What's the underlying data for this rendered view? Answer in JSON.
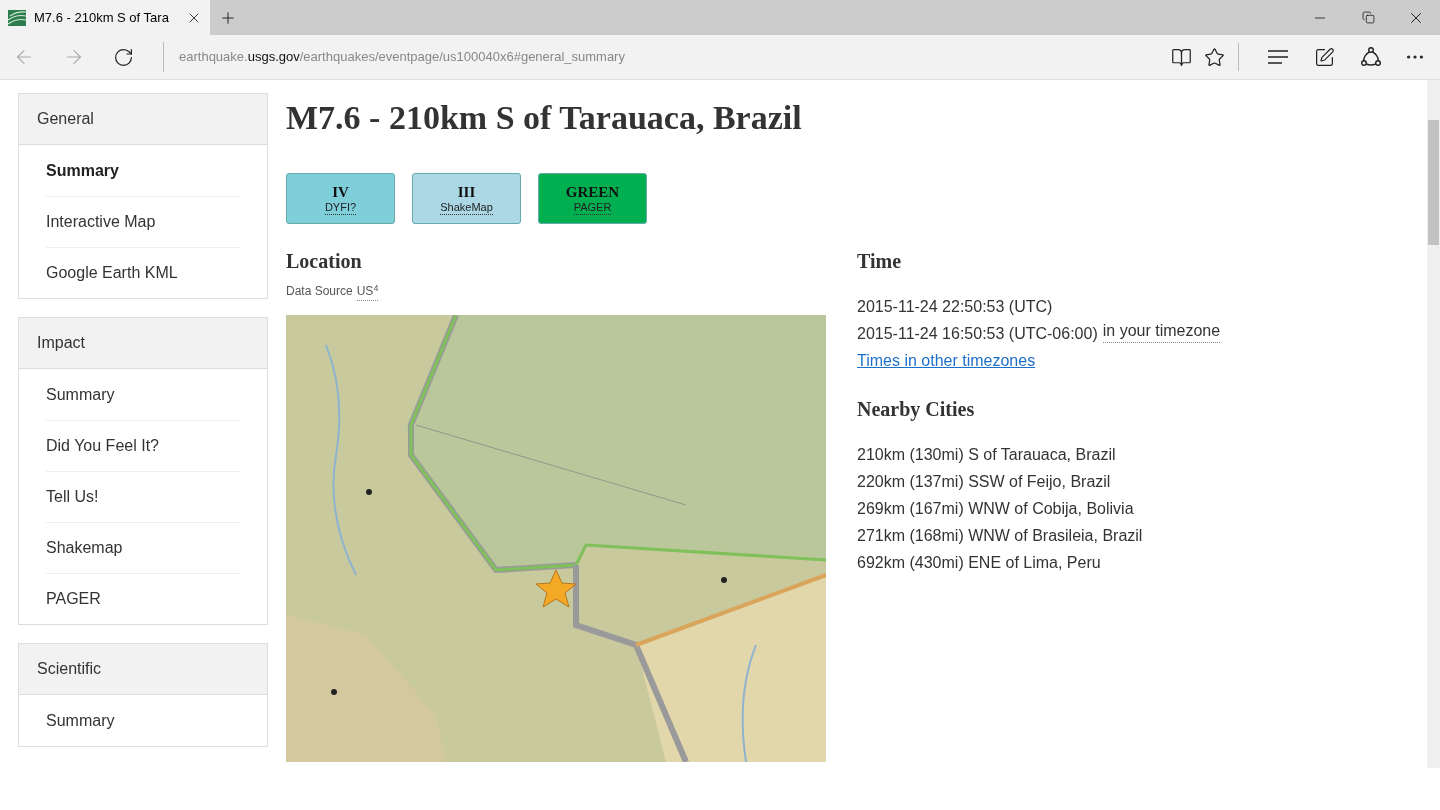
{
  "browser": {
    "tab": {
      "title": "M7.6 - 210km S of Tara",
      "selected": true
    },
    "url": {
      "prefix": "earthquake.",
      "domain": "usgs.gov",
      "path": "/earthquakes/eventpage/us100040x6#general_summary"
    }
  },
  "sidebar": {
    "sections": [
      {
        "title": "General",
        "items": [
          {
            "label": "Summary",
            "selected": true
          },
          {
            "label": "Interactive Map",
            "selected": false
          },
          {
            "label": "Google Earth KML",
            "selected": false
          }
        ]
      },
      {
        "title": "Impact",
        "items": [
          {
            "label": "Summary",
            "selected": false
          },
          {
            "label": "Did You Feel It?",
            "selected": false
          },
          {
            "label": "Tell Us!",
            "selected": false
          },
          {
            "label": "Shakemap",
            "selected": false
          },
          {
            "label": "PAGER",
            "selected": false
          }
        ]
      },
      {
        "title": "Scientific",
        "items": [
          {
            "label": "Summary",
            "selected": false
          }
        ]
      }
    ]
  },
  "main": {
    "title": "M7.6 - 210km S of Tarauaca, Brazil",
    "badges": [
      {
        "value": "IV",
        "label": "DYFI?",
        "color": "#7fcfdb"
      },
      {
        "value": "III",
        "label": "ShakeMap",
        "color": "#acd8e6"
      },
      {
        "value": "GREEN",
        "label": "PAGER",
        "color": "#00b050"
      }
    ],
    "location": {
      "heading": "Location",
      "data_source": "Data Source",
      "source": "US$^{4}$"
    },
    "time": {
      "heading": "Time",
      "utc": "2015-11-24 22:50:53 (UTC)",
      "local": "2015-11-24 16:50:53 (UTC-06:00)",
      "local_link": "in your timezone",
      "other_link": "Times in other timezones"
    },
    "nearby": {
      "heading": "Nearby Cities",
      "cities": [
        "210km (130mi) S of Tarauaca, Brazil",
        "220km (137mi) SSW of Feijo, Brazil",
        "269km (167mi) WNW of Cobija, Bolivia",
        "271km (168mi) WNW of Brasileia, Brazil",
        "692km (430mi) ENE of Lima, Peru"
      ]
    }
  }
}
